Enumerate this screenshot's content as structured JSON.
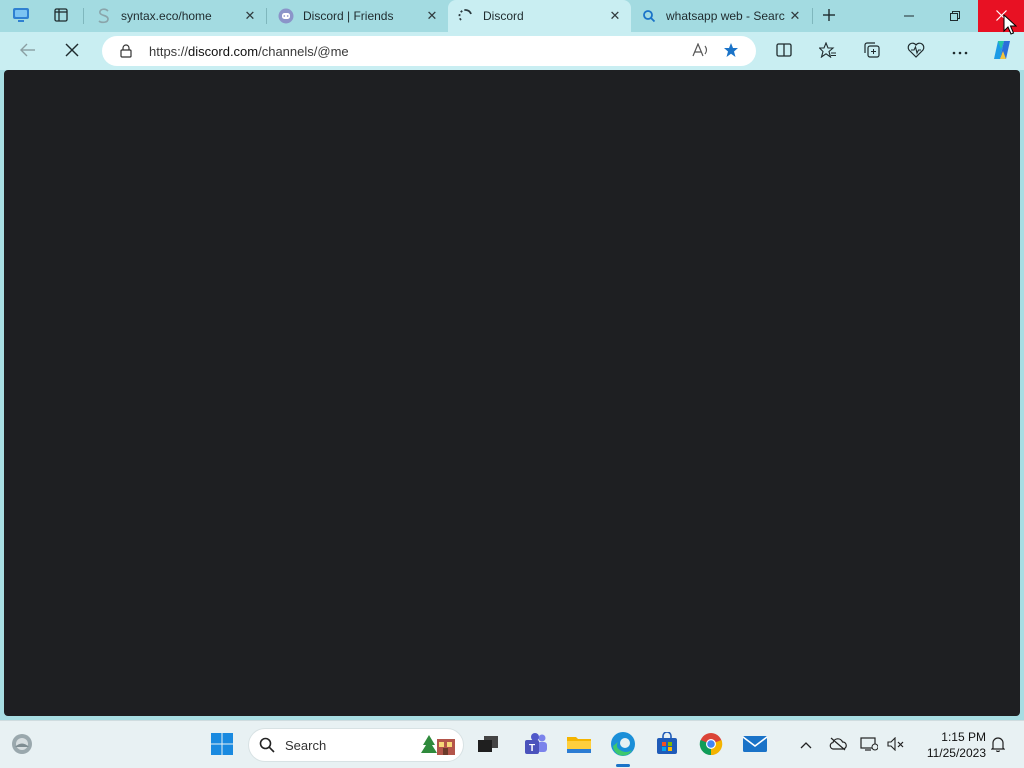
{
  "browser": {
    "tabs": [
      {
        "title": "syntax.eco/home",
        "favicon": "syntax-s-icon",
        "active": false
      },
      {
        "title": "Discord | Friends",
        "favicon": "discord-icon",
        "active": false
      },
      {
        "title": "Discord",
        "favicon": "loading-spinner-icon",
        "active": true
      },
      {
        "title": "whatsapp web - Searc",
        "favicon": "search-icon",
        "active": false
      }
    ],
    "new_tab_icon": "plus-icon",
    "window_controls": [
      "minimize-icon",
      "restore-icon",
      "close-icon"
    ],
    "address": {
      "url_prefix": "https://",
      "url_domain": "discord.com",
      "url_path": "/channels/@me"
    },
    "toolbar_icons": [
      "back-arrow-icon",
      "stop-loading-icon",
      "lock-icon",
      "read-aloud-icon",
      "favorite-star-icon",
      "split-screen-icon",
      "favorites-icon",
      "collections-icon",
      "browser-essentials-icon",
      "more-options-icon",
      "copilot-icon"
    ]
  },
  "taskbar": {
    "search_label": "Search",
    "clock_time": "1:15 PM",
    "clock_date": "11/25/2023",
    "pinned": [
      "start-icon",
      "search-icon",
      "task-view-icon",
      "teams-icon",
      "file-explorer-icon",
      "edge-icon",
      "store-icon",
      "chrome-icon",
      "mail-icon"
    ],
    "tray": [
      "chevron-up-icon",
      "onedrive-icon",
      "network-icon",
      "volume-muted-icon",
      "notification-bell-icon"
    ]
  },
  "colors": {
    "tabbar": "#a3dbe1",
    "toolbar": "#c9eef2",
    "content": "#1e1f22",
    "close_red": "#e81123",
    "accent": "#1a73c8"
  }
}
